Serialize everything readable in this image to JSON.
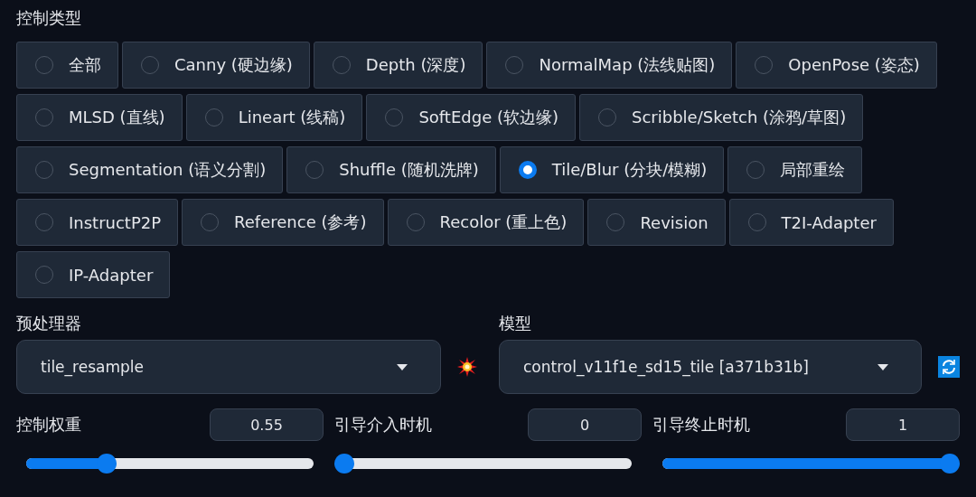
{
  "control_type": {
    "label": "控制类型",
    "options": [
      {
        "label": "全部",
        "selected": false
      },
      {
        "label": "Canny (硬边缘)",
        "selected": false
      },
      {
        "label": "Depth (深度)",
        "selected": false
      },
      {
        "label": "NormalMap (法线贴图)",
        "selected": false
      },
      {
        "label": "OpenPose (姿态)",
        "selected": false
      },
      {
        "label": "MLSD (直线)",
        "selected": false
      },
      {
        "label": "Lineart (线稿)",
        "selected": false
      },
      {
        "label": "SoftEdge (软边缘)",
        "selected": false
      },
      {
        "label": "Scribble/Sketch (涂鸦/草图)",
        "selected": false
      },
      {
        "label": "Segmentation (语义分割)",
        "selected": false
      },
      {
        "label": "Shuffle (随机洗牌)",
        "selected": false
      },
      {
        "label": "Tile/Blur (分块/模糊)",
        "selected": true
      },
      {
        "label": "局部重绘",
        "selected": false
      },
      {
        "label": "InstructP2P",
        "selected": false
      },
      {
        "label": "Reference (参考)",
        "selected": false
      },
      {
        "label": "Recolor (重上色)",
        "selected": false
      },
      {
        "label": "Revision",
        "selected": false
      },
      {
        "label": "T2I-Adapter",
        "selected": false
      },
      {
        "label": "IP-Adapter",
        "selected": false
      }
    ]
  },
  "preprocessor": {
    "label": "预处理器",
    "value": "tile_resample"
  },
  "model": {
    "label": "模型",
    "value": "control_v11f1e_sd15_tile [a371b31b]"
  },
  "sliders": [
    {
      "label": "控制权重",
      "value": "0.55",
      "level": 0.28
    },
    {
      "label": "引导介入时机",
      "value": "0",
      "level": 0
    },
    {
      "label": "引导终止时机",
      "value": "1",
      "level": 1
    }
  ]
}
